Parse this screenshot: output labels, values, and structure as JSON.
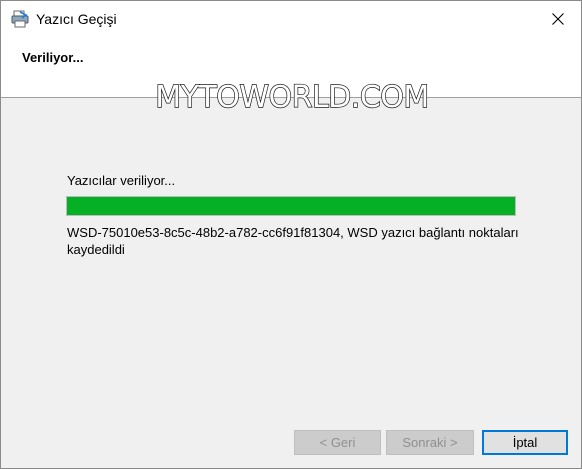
{
  "window": {
    "title": "Yazıcı Geçişi",
    "icon": "printer-migration-icon"
  },
  "header": {
    "title": "Veriliyor..."
  },
  "watermark": {
    "text": "MYTOWORLD.COM"
  },
  "main": {
    "status_label": "Yazıcılar veriliyor...",
    "progress_percent": 100,
    "progress_color": "#06b025",
    "detail_text": "WSD-75010e53-8c5c-48b2-a782-cc6f91f81304, WSD yazıcı bağlantı noktaları kaydedildi"
  },
  "buttons": {
    "back_label": "< Geri",
    "next_label": "Sonraki >",
    "cancel_label": "İptal"
  }
}
